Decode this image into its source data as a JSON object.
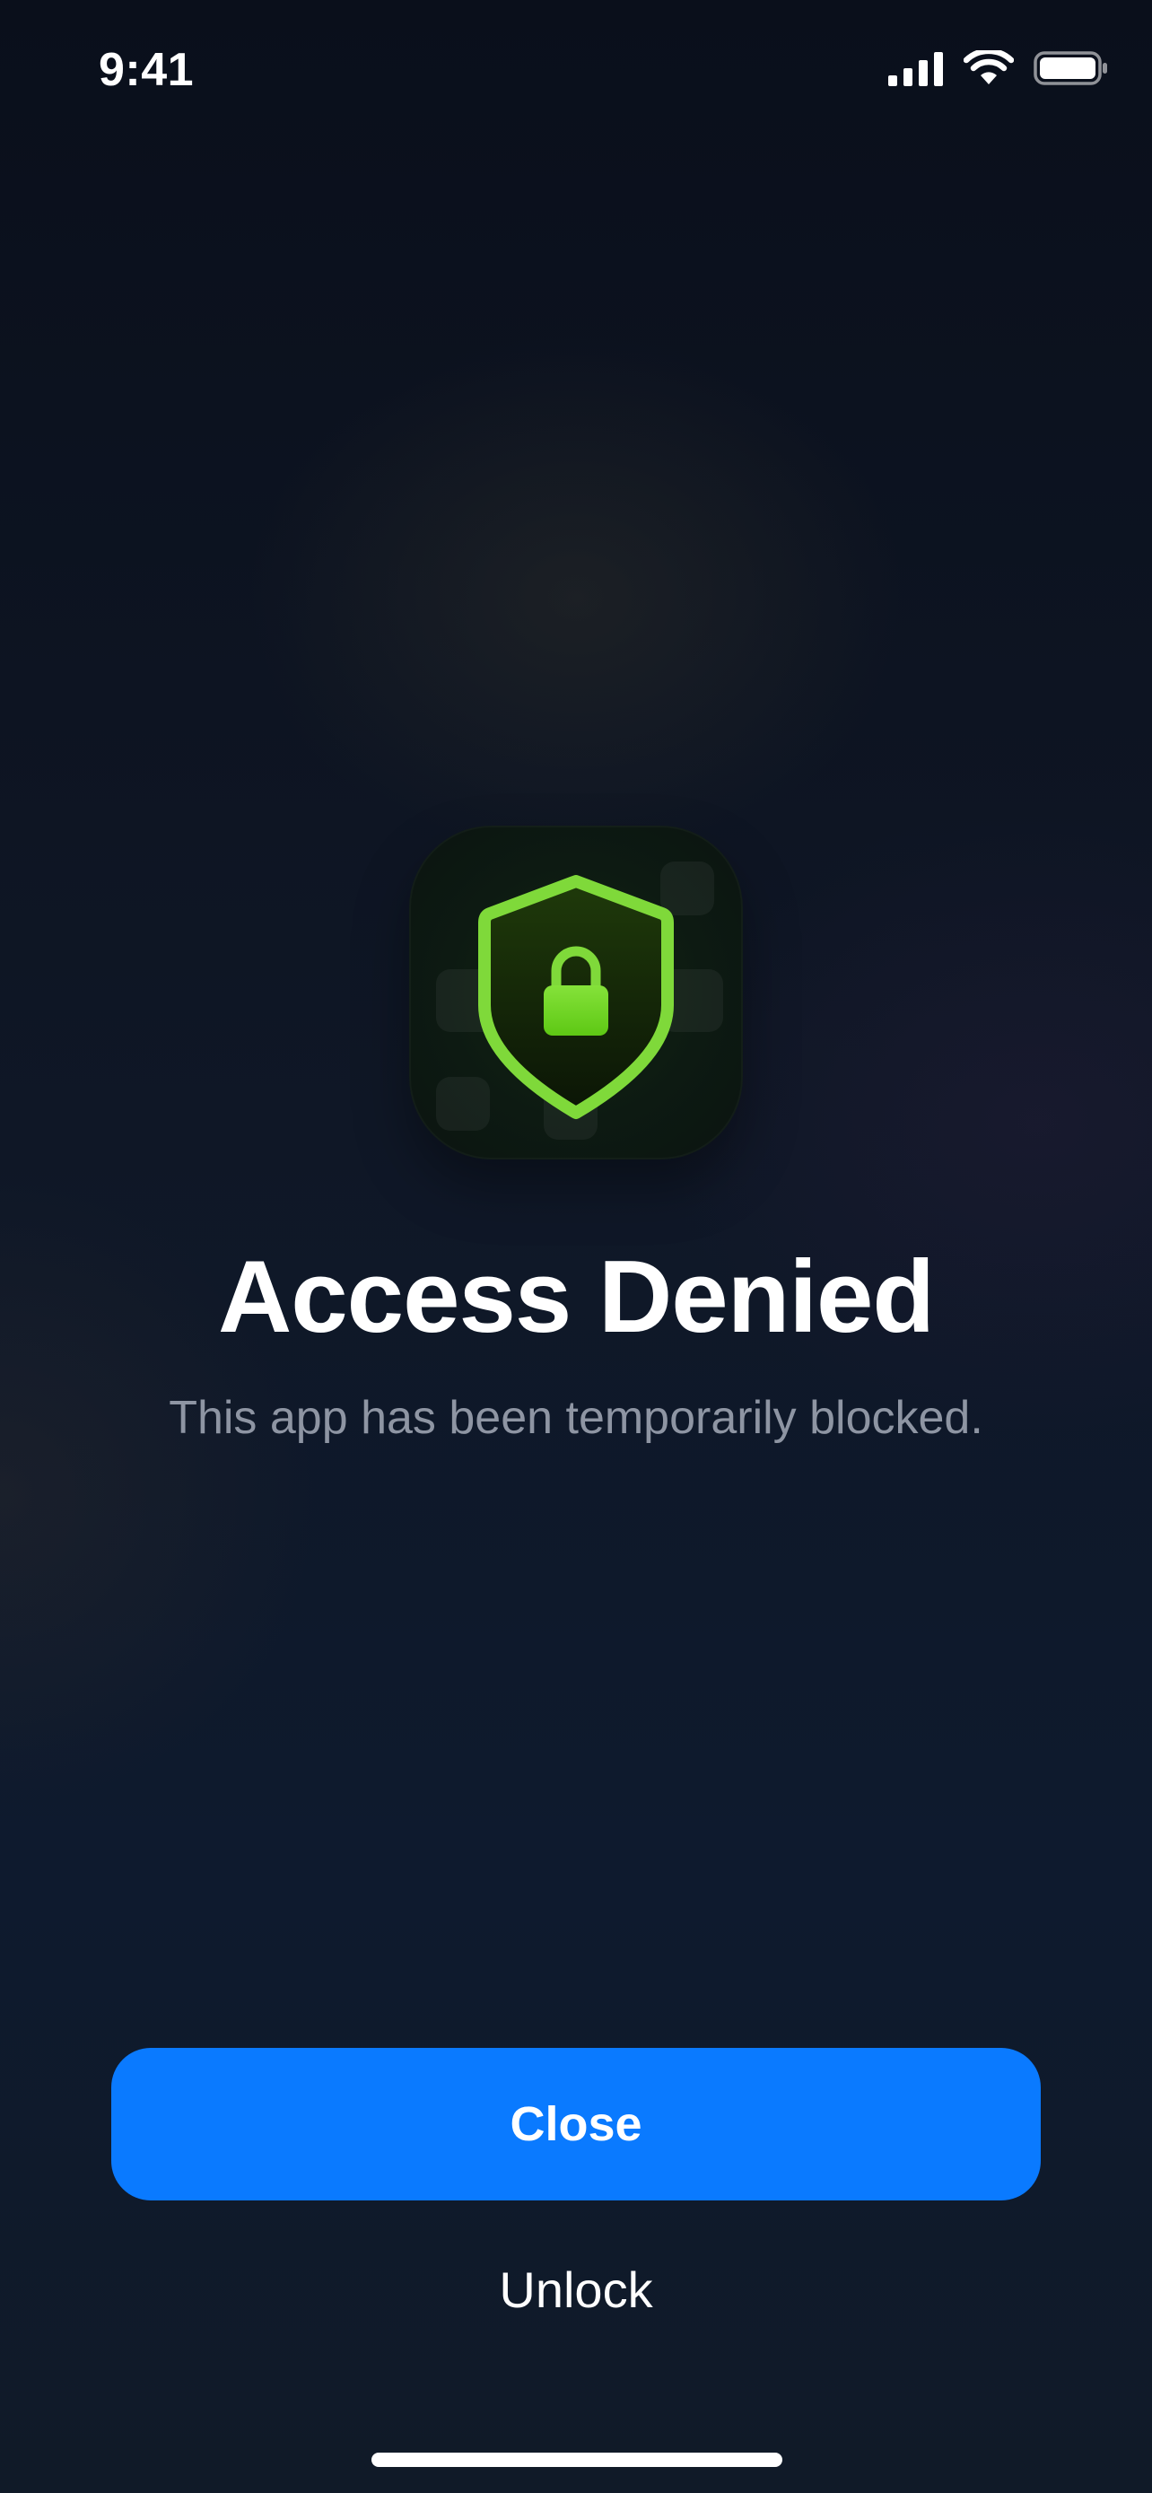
{
  "status_bar": {
    "time": "9:41",
    "icons": [
      "cellular-signal-icon",
      "wifi-icon",
      "battery-icon"
    ]
  },
  "app_icon": {
    "icon": "shield-lock-icon",
    "colors": {
      "shield_stroke": "#7fd93a",
      "lock_fill": "#6fd41c",
      "background": "#0d1a12"
    }
  },
  "message": {
    "title": "Access Denied",
    "subtitle": "This app has been temporarily blocked."
  },
  "actions": {
    "close_label": "Close",
    "unlock_label": "Unlock"
  },
  "colors": {
    "primary_button": "#0a7aff",
    "subtitle_text": "#8e95a3"
  }
}
